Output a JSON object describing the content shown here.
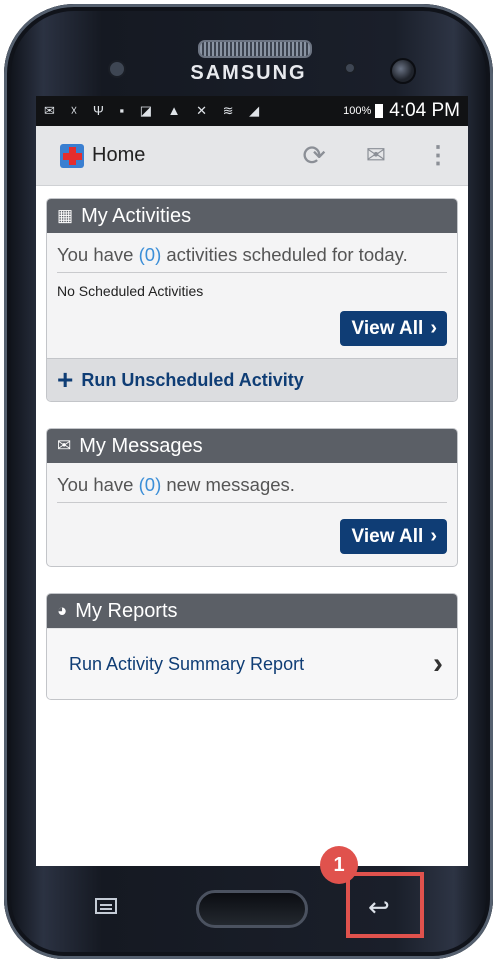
{
  "device": {
    "brand": "SAMSUNG"
  },
  "status_bar": {
    "icons": "✉ ☓ Ψ ▪ ◪ ▲ ✕ ≋ ◢",
    "battery": "100%",
    "time": "4:04 PM"
  },
  "app_bar": {
    "title": "Home",
    "sync_icon": "sync-icon",
    "mail_icon": "mail-icon",
    "menu_icon": "overflow-menu-icon"
  },
  "activities": {
    "header": "My Activities",
    "msg_prefix": "You have ",
    "count": "(0)",
    "msg_suffix": " activities scheduled for today.",
    "empty_text": "No Scheduled Activities",
    "view_all": "View All",
    "run_unscheduled": "Run Unscheduled Activity"
  },
  "messages": {
    "header": "My Messages",
    "msg_prefix": "You have ",
    "count": "(0)",
    "msg_suffix": " new messages.",
    "view_all": "View All"
  },
  "reports": {
    "header": "My Reports",
    "run_summary": "Run Activity Summary Report"
  },
  "annotation": {
    "badge": "1",
    "highlight_color": "#e0524d"
  },
  "colors": {
    "accent": "#0f3d75",
    "count": "#3c8fd8",
    "header_bg": "#5b5f66"
  }
}
